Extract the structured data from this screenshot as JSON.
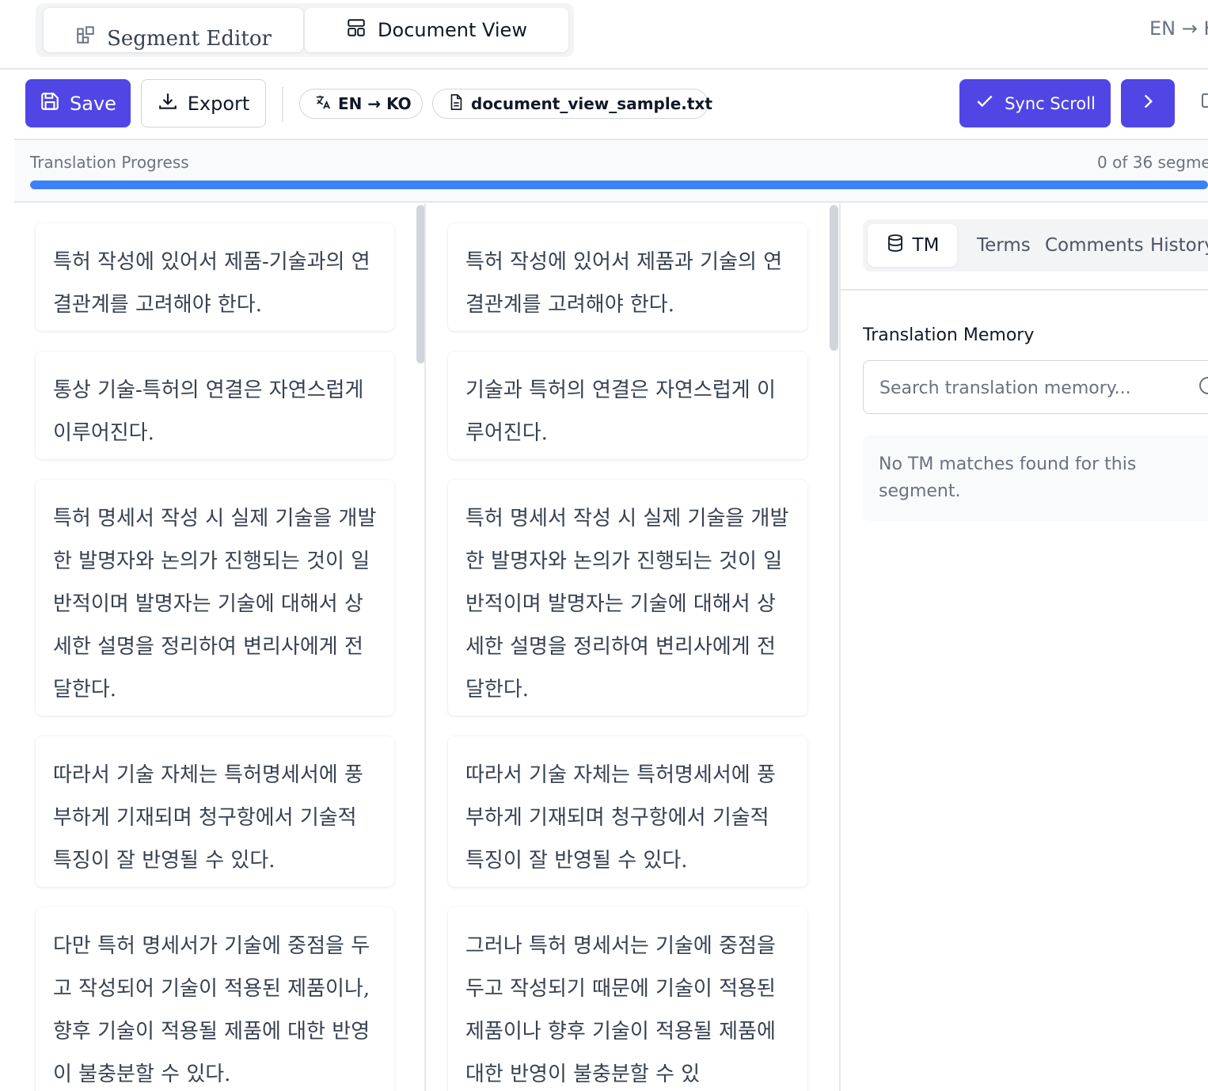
{
  "view_switch": {
    "segment_editor_label": "Segment Editor",
    "document_view_label": "Document View",
    "active": "Document View"
  },
  "header_lang": "EN → K",
  "toolbar": {
    "save_label": "Save",
    "export_label": "Export",
    "lang_pair": "EN → KO",
    "file_name": "document_view_sample.txt",
    "sync_scroll_label": "Sync Scroll",
    "accent_color": "#4f46e5"
  },
  "progress": {
    "label": "Translation Progress",
    "count_text": "0 of 36 segme",
    "fill_fraction": 1.0,
    "bar_color": "#3b82f6"
  },
  "segments": [
    {
      "source": "특허 작성에 있어서 제품-기술과의 연결관계를 고려해야 한다.",
      "target": "특허 작성에 있어서 제품과 기술의 연결관계를 고려해야 한다."
    },
    {
      "source": "통상 기술-특허의 연결은 자연스럽게 이루어진다.",
      "target": "기술과 특허의 연결은 자연스럽게 이루어진다."
    },
    {
      "source": "특허 명세서 작성 시 실제 기술을 개발한 발명자와 논의가 진행되는 것이 일반적이며 발명자는 기술에 대해서 상세한 설명을 정리하여 변리사에게 전달한다.",
      "target": "특허 명세서 작성 시 실제 기술을 개발한 발명자와 논의가 진행되는 것이 일반적이며 발명자는 기술에 대해서 상세한 설명을 정리하여 변리사에게 전달한다."
    },
    {
      "source": "따라서 기술 자체는 특허명세서에 풍부하게 기재되며 청구항에서 기술적 특징이 잘 반영될 수 있다.",
      "target": "따라서 기술 자체는 특허명세서에 풍부하게 기재되며 청구항에서 기술적 특징이 잘 반영될 수 있다."
    },
    {
      "source": "다만 특허 명세서가 기술에 중점을 두고 작성되어 기술이 적용된 제품이나, 향후 기술이 적용될 제품에 대한 반영이 불충분할 수 있다.",
      "target": "그러나 특허 명세서는 기술에 중점을 두고 작성되기 때문에 기술이 적용된 제품이나 향후 기술이 적용될 제품에 대한 반영이 불충분할 수 있"
    }
  ],
  "side_panel": {
    "tabs": [
      "TM",
      "Terms",
      "Comments",
      "History"
    ],
    "active_tab": "TM",
    "heading": "Translation Memory",
    "search_placeholder": "Search translation memory...",
    "empty_message": "No TM matches found for this segment."
  }
}
